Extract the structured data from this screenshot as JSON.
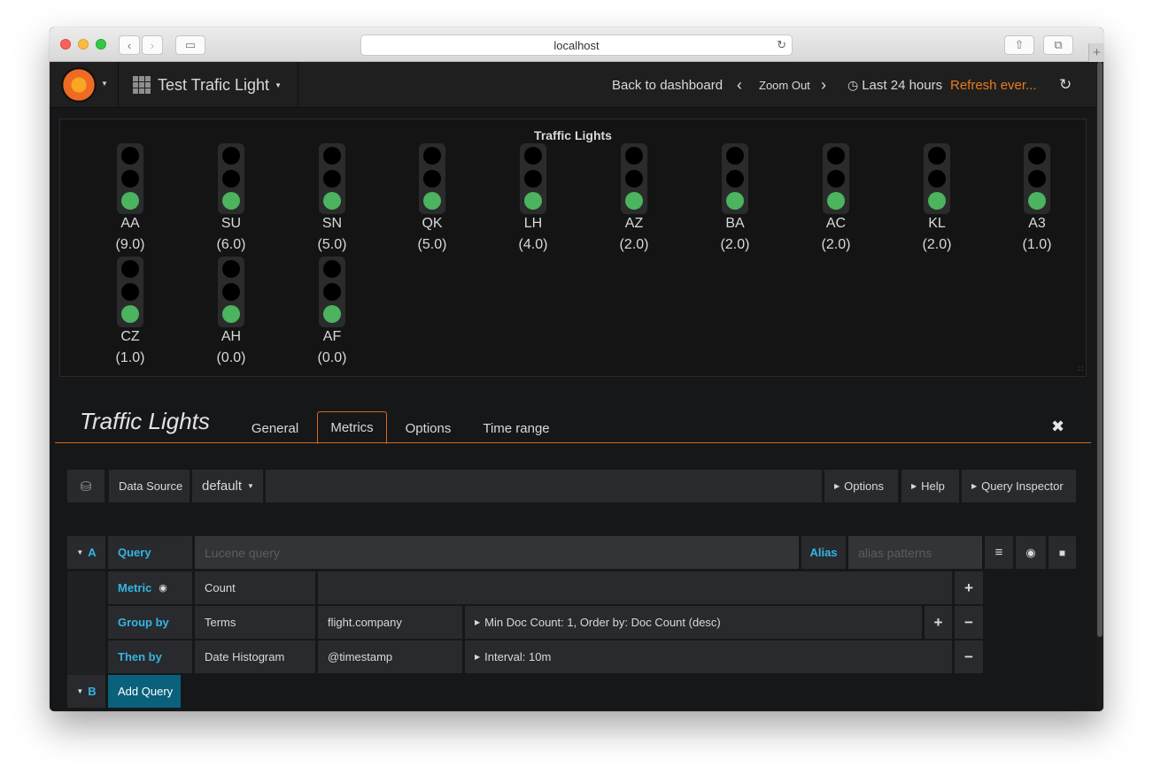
{
  "browser": {
    "url": "localhost"
  },
  "navbar": {
    "dashboard_title": "Test Trafic Light",
    "back_to_dashboard": "Back to dashboard",
    "zoom_out": "Zoom Out",
    "time_range": "Last 24 hours",
    "refresh": "Refresh ever..."
  },
  "panel": {
    "title": "Traffic Lights",
    "lights": [
      {
        "code": "AA",
        "value": "(9.0)"
      },
      {
        "code": "SU",
        "value": "(6.0)"
      },
      {
        "code": "SN",
        "value": "(5.0)"
      },
      {
        "code": "QK",
        "value": "(5.0)"
      },
      {
        "code": "LH",
        "value": "(4.0)"
      },
      {
        "code": "AZ",
        "value": "(2.0)"
      },
      {
        "code": "BA",
        "value": "(2.0)"
      },
      {
        "code": "AC",
        "value": "(2.0)"
      },
      {
        "code": "KL",
        "value": "(2.0)"
      },
      {
        "code": "A3",
        "value": "(1.0)"
      },
      {
        "code": "CZ",
        "value": "(1.0)"
      },
      {
        "code": "AH",
        "value": "(0.0)"
      },
      {
        "code": "AF",
        "value": "(0.0)"
      }
    ]
  },
  "editor": {
    "title": "Traffic Lights",
    "tabs": [
      "General",
      "Metrics",
      "Options",
      "Time range"
    ],
    "active_tab": "Metrics",
    "datasource_label": "Data Source",
    "datasource_value": "default",
    "options_btn": "Options",
    "help_btn": "Help",
    "inspector_btn": "Query Inspector",
    "query": {
      "letter": "A",
      "label": "Query",
      "placeholder": "Lucene query",
      "alias_label": "Alias",
      "alias_placeholder": "alias patterns",
      "metric_label": "Metric",
      "metric_value": "Count",
      "groupby_label": "Group by",
      "groupby_type": "Terms",
      "groupby_field": "flight.company",
      "groupby_options": "Min Doc Count: 1, Order by: Doc Count (desc)",
      "thenby_label": "Then by",
      "thenby_type": "Date Histogram",
      "thenby_field": "@timestamp",
      "thenby_options": "Interval: 10m"
    },
    "query_b_letter": "B",
    "add_query": "Add Query"
  },
  "colors": {
    "accent": "#eb7b18",
    "query_blue": "#33b5e5",
    "light_on": "#4cb35f"
  }
}
